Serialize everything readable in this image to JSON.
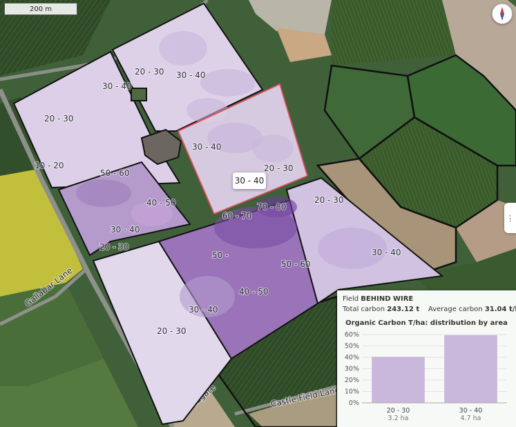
{
  "map": {
    "scale_label": "200 m",
    "road_labels": [
      "Gallabar Lane",
      "Castle Field Lane",
      "Broadgate"
    ],
    "zones": [
      {
        "label": "20 - 30"
      },
      {
        "label": "30 - 40"
      },
      {
        "label": "30 - 40"
      },
      {
        "label": "20 - 30"
      },
      {
        "label": "10 - 20"
      },
      {
        "label": "30 - 40"
      },
      {
        "label": "20 - 30"
      },
      {
        "label": "50 - 60"
      },
      {
        "label": "40 - 50"
      },
      {
        "label": "30 - 40"
      },
      {
        "label": "20 - 30"
      },
      {
        "label": "70 - 80"
      },
      {
        "label": "60 - 70"
      },
      {
        "label": "50 -"
      },
      {
        "label": "50 - 60"
      },
      {
        "label": "40 - 50"
      },
      {
        "label": "30 - 40"
      },
      {
        "label": "20 - 30"
      },
      {
        "label": "20 - 30"
      },
      {
        "label": "30 - 40"
      }
    ],
    "tooltip": "30 - 40",
    "handle_glyph": "⋮",
    "selected_color": "#e05060"
  },
  "panel": {
    "field_prefix": "Field",
    "field_name": "BEHIND WIRE",
    "total_label": "Total carbon",
    "total_value": "243.12 t",
    "avg_label": "Average carbon",
    "avg_value": "31.04 t/ha",
    "chart_title": "Organic Carbon T/ha: distribution by area"
  },
  "chart_data": {
    "type": "bar",
    "title": "Organic Carbon T/ha: distribution by area",
    "categories": [
      "20 - 30",
      "30 - 40"
    ],
    "sublabels": [
      "3.2 ha",
      "4.7 ha"
    ],
    "values": [
      40.5,
      59.5
    ],
    "ylim": [
      0,
      60
    ],
    "yticks": [
      "0%",
      "10%",
      "20%",
      "30%",
      "40%",
      "50%",
      "60%"
    ],
    "grid": true,
    "bar_color": "#c9b7dc"
  }
}
